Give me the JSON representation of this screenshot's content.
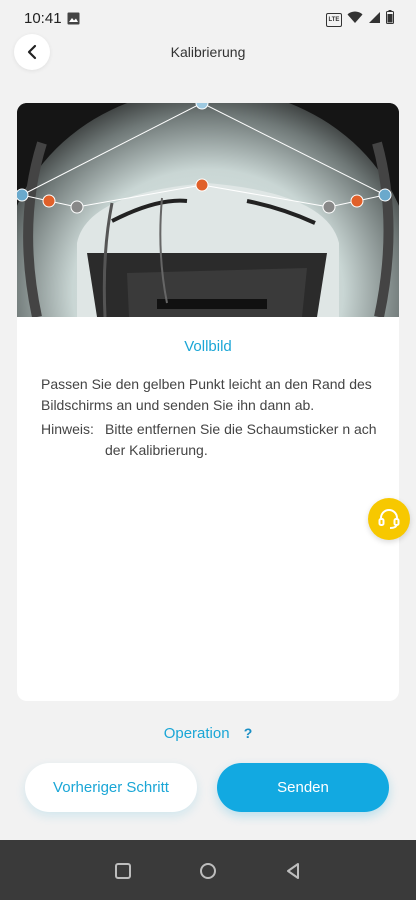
{
  "status_bar": {
    "time": "10:41",
    "network_badge": "LTE"
  },
  "header": {
    "title": "Kalibrierung"
  },
  "camera": {
    "alt_label": "camera preview"
  },
  "content": {
    "fullscreen_label": "Vollbild",
    "instruction": "Passen Sie den gelben Punkt leicht an den Rand des Bildschirms an und senden Sie ihn dann ab.",
    "hint_label": "Hinweis:",
    "hint_text": "Bitte entfernen Sie die Schaumsticker n ach der Kalibrierung."
  },
  "operation": {
    "label": "Operation",
    "help": "?"
  },
  "buttons": {
    "previous": "Vorheriger Schritt",
    "send": "Senden"
  },
  "colors": {
    "accent": "#1aa6d6",
    "primary_button": "#12a9e1",
    "support": "#f7c800"
  }
}
